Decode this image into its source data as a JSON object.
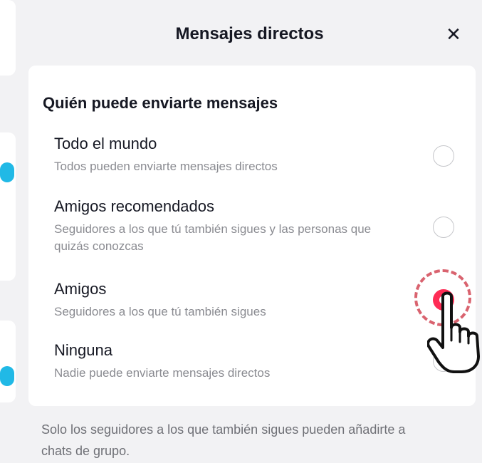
{
  "sheet": {
    "title": "Mensajes directos",
    "close_label": "✕"
  },
  "section": {
    "title": "Quién puede enviarte mensajes"
  },
  "options": [
    {
      "label": "Todo el mundo",
      "description": "Todos pueden enviarte mensajes directos",
      "selected": false
    },
    {
      "label": "Amigos recomendados",
      "description": "Seguidores a los que tú también sigues y las personas que quizás conozcas",
      "selected": false
    },
    {
      "label": "Amigos",
      "description": "Seguidores a los que tú también sigues",
      "selected": true
    },
    {
      "label": "Ninguna",
      "description": "Nadie puede enviarte mensajes directos",
      "selected": false
    }
  ],
  "footer": {
    "note": "Solo los seguidores a los que también sigues pueden añadirte a chats de grupo."
  },
  "colors": {
    "accent": "#fe2c55",
    "highlight": "#d9636f",
    "left_dot": "#21b9e6"
  },
  "icons": [
    "close-icon",
    "radio-icon",
    "hand-pointer-icon"
  ]
}
